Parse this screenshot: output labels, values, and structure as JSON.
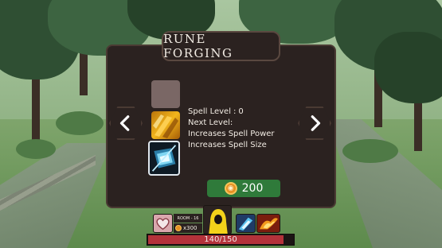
{
  "panel": {
    "title": "RUNE FORGING",
    "stats": [
      {
        "label": "Spell Level",
        "value": "0"
      },
      {
        "label": "Next Level",
        "value": ""
      }
    ],
    "effects": [
      "Increases Spell Power",
      "Increases Spell Size"
    ],
    "cost": "200"
  },
  "hud": {
    "room": "ROOM - 16",
    "gold": "x300",
    "hp_text": "140/150",
    "hp_current": 140,
    "hp_max": 150
  },
  "colors": {
    "panel_bg": "#2b2220",
    "cost_button": "#2f7a3a",
    "hp_fill": "#b3323a",
    "coin": "#e79223"
  },
  "icons": {
    "prev": "chevron-left-icon",
    "next": "chevron-right-icon",
    "rune_empty": "empty-rune-slot",
    "rune_fire": "fire-rune-icon",
    "rune_ice": "ice-rune-icon",
    "coin": "gold-coin-icon"
  }
}
